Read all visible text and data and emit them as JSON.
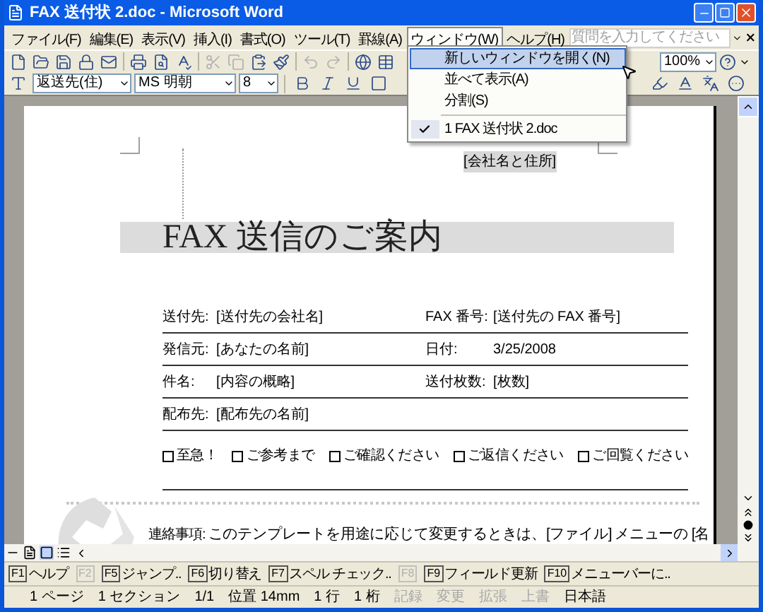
{
  "window": {
    "title": "FAX 送付状 2.doc - Microsoft Word"
  },
  "menu": [
    {
      "label": "ファイル(F)",
      "selected": false
    },
    {
      "label": "編集(E)",
      "selected": false
    },
    {
      "label": "表示(V)",
      "selected": false
    },
    {
      "label": "挿入(I)",
      "selected": false
    },
    {
      "label": "書式(O)",
      "selected": false
    },
    {
      "label": "ツール(T)",
      "selected": false
    },
    {
      "label": "罫線(A)",
      "selected": false
    },
    {
      "label": "ウィンドウ(W)",
      "selected": true
    },
    {
      "label": "ヘルプ(H)",
      "selected": false
    }
  ],
  "help_search": {
    "placeholder": "質問を入力してください"
  },
  "toolbar": {
    "style": "返送先(住)",
    "font": "MS 明朝",
    "size": "8",
    "zoom": "100%"
  },
  "window_menu": [
    {
      "label": "新しいウィンドウを開く(N)",
      "selected": true,
      "checked": false,
      "separator_before": false
    },
    {
      "label": "並べて表示(A)",
      "selected": false,
      "checked": false,
      "separator_before": false
    },
    {
      "label": "分割(S)",
      "selected": false,
      "checked": false,
      "separator_before": false
    },
    {
      "label": "1 FAX 送付状 2.doc",
      "selected": false,
      "checked": true,
      "separator_before": true
    }
  ],
  "document": {
    "header": "[会社名と住所]",
    "title": "FAX 送信のご案内",
    "rows": [
      {
        "cells": [
          {
            "label": "送付先:",
            "value": "[送付先の会社名]"
          },
          {
            "label": "FAX 番号:",
            "value": "[送付先の FAX 番号]"
          }
        ]
      },
      {
        "cells": [
          {
            "label": "発信元:",
            "value": "[あなたの名前]"
          },
          {
            "label": "日付:",
            "value": "3/25/2008"
          }
        ]
      },
      {
        "cells": [
          {
            "label": "件名:",
            "value": "[内容の概略]"
          },
          {
            "label": "送付枚数:",
            "value": "[枚数]"
          }
        ]
      },
      {
        "cells": [
          {
            "label": "配布先:",
            "value": "[配布先の名前]"
          }
        ]
      }
    ],
    "options": [
      {
        "label": "至急！",
        "checked": false
      },
      {
        "label": "ご参考まで",
        "checked": false
      },
      {
        "label": "ご確認ください",
        "checked": false
      },
      {
        "label": "ご返信ください",
        "checked": false
      },
      {
        "label": "ご回覧ください",
        "checked": false
      }
    ],
    "note": {
      "label": "連絡事項:",
      "text": "このテンプレートを用途に応じて変更するときは、[ファイル] メニューの [名"
    }
  },
  "function_keys": [
    {
      "key": "F1",
      "label": "ヘルプ",
      "disabled": false
    },
    {
      "key": "F2",
      "disabled": true
    },
    {
      "key": "F5",
      "label": "ジャンプ..",
      "disabled": false
    },
    {
      "key": "F6",
      "label": "切り替え",
      "disabled": false
    },
    {
      "key": "F7",
      "label": "スペル チェック..",
      "disabled": false
    },
    {
      "key": "F8",
      "disabled": true
    },
    {
      "key": "F9",
      "label": "フィールド更新",
      "disabled": false
    },
    {
      "key": "F10",
      "label": "メニューバーに..",
      "disabled": false
    }
  ],
  "status_bar": [
    {
      "text": "1 ページ",
      "disabled": false
    },
    {
      "text": "1 セクション",
      "disabled": false
    },
    {
      "text": "1/1",
      "disabled": false
    },
    {
      "text": "位置 14mm",
      "disabled": false
    },
    {
      "text": "1 行",
      "disabled": false
    },
    {
      "text": "1 桁",
      "disabled": false
    },
    {
      "text": "記録",
      "disabled": true
    },
    {
      "text": "変更",
      "disabled": true
    },
    {
      "text": "拡張",
      "disabled": true
    },
    {
      "text": "上書",
      "disabled": true
    },
    {
      "text": "日本語",
      "disabled": false
    }
  ]
}
